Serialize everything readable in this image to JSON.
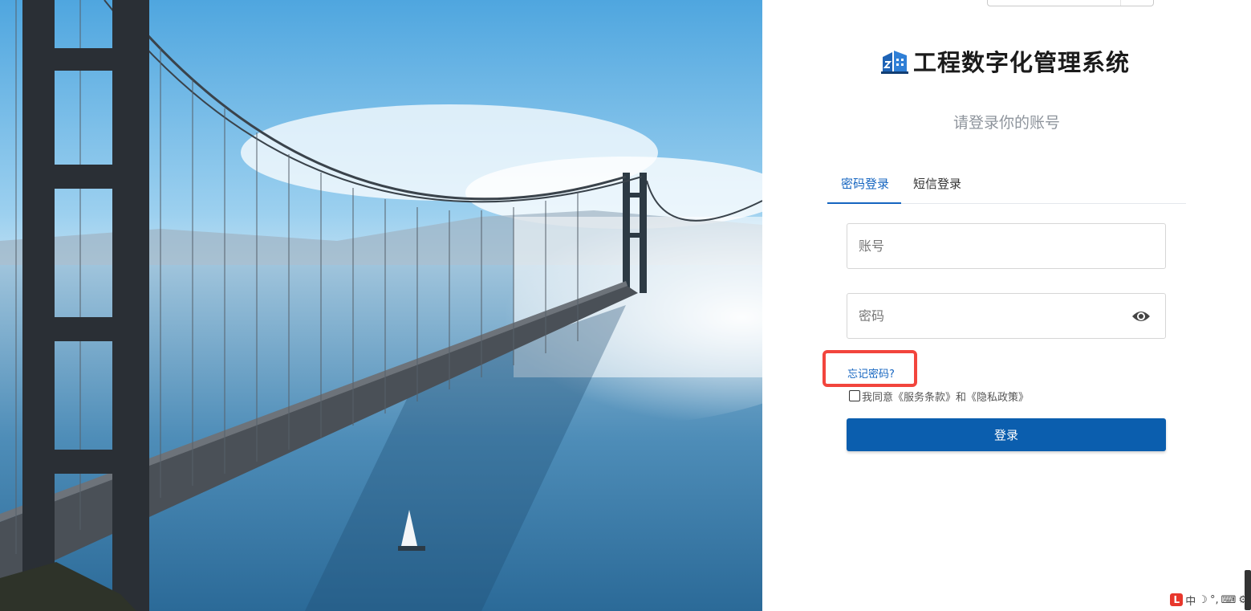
{
  "brand": {
    "title": "工程数字化管理系统",
    "logo_icon": "building-logo-icon",
    "logo_color": "#1e63b6"
  },
  "subtitle": "请登录你的账号",
  "tabs": [
    {
      "label": "密码登录",
      "active": true
    },
    {
      "label": "短信登录",
      "active": false
    }
  ],
  "account_field": {
    "placeholder": "账号",
    "value": ""
  },
  "password_field": {
    "placeholder": "密码",
    "value": "",
    "toggle_icon": "eye-icon"
  },
  "forgot_password": "忘记密码?",
  "agreement": {
    "text": "我同意《服务条款》和《隐私政策》",
    "checked": false
  },
  "login_button": "登录",
  "ime": {
    "logo": "L",
    "mode": "中",
    "moon": "☽",
    "punct": "°,",
    "keyboard": "⌨",
    "gear": "⚙"
  },
  "colors": {
    "primary": "#0b5eae",
    "link": "#1565c0",
    "highlight": "#f2453d"
  }
}
